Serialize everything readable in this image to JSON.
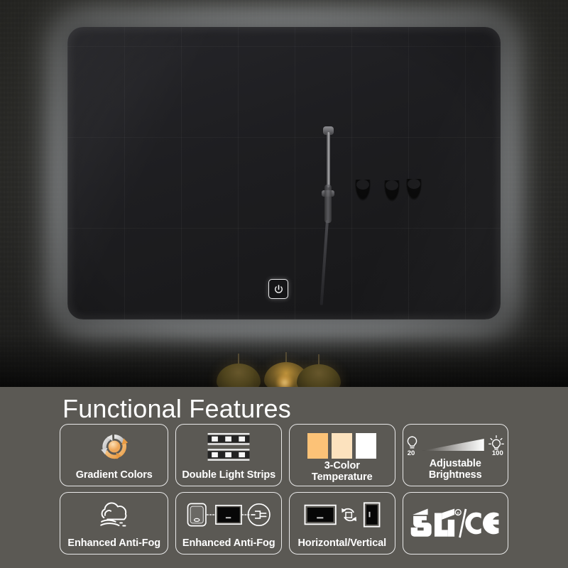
{
  "scene": {
    "name": "backlit-led-bathroom-mirror",
    "mirror": {
      "touch_button_icon": "power-icon",
      "reflection_items": [
        "shower-fixture",
        "wall-hook",
        "wall-hook",
        "wall-hook"
      ]
    },
    "pendant_lights_count": 3
  },
  "panel": {
    "title": "Functional Features",
    "background_color": "#5b5954",
    "border_color": "#e9e9e9",
    "text_color": "#ffffff"
  },
  "features": {
    "row1": [
      {
        "label": "Gradient Colors",
        "icon": "gradient-color-cycle-icon",
        "lines": 1,
        "accent": "#f0aa5e"
      },
      {
        "label": "Double Light Strips",
        "icon": "double-light-strip-icon",
        "lines": 1,
        "accent": "#ffffff"
      },
      {
        "label_line1": "3-Color",
        "label_line2": "Temperature",
        "icon": "color-temperature-swatches-icon",
        "lines": 2,
        "swatches": [
          "#fcc277",
          "#fce2be",
          "#ffffff"
        ]
      },
      {
        "label": "Adjustable Brightness",
        "icon": "adjustable-brightness-icon",
        "lines": 1,
        "min_value": "20",
        "max_value": "100"
      }
    ],
    "row2": [
      {
        "label": "Enhanced Anti-Fog",
        "icon": "anti-fog-cloud-icon",
        "lines": 1
      },
      {
        "label": "Enhanced Anti-Fog",
        "icon": "defogger-switch-plug-icon",
        "lines": 1
      },
      {
        "label": "Horizontal/Vertical",
        "icon": "horizontal-vertical-rotate-icon",
        "lines": 1
      },
      {
        "label": "",
        "icon": "ul-ce-certification-icon",
        "lines": 0,
        "marks": [
          "UL",
          "CE"
        ]
      }
    ]
  }
}
